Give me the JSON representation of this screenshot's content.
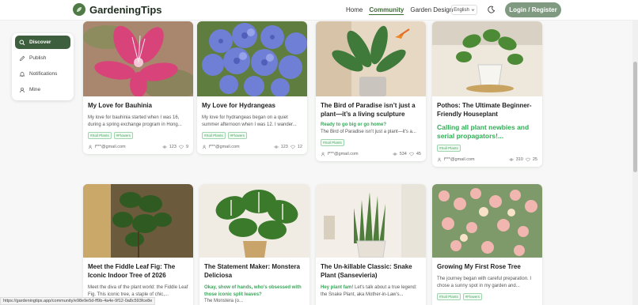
{
  "header": {
    "logo_text": "GardeningTips",
    "nav": [
      "Home",
      "Community",
      "Garden Design"
    ],
    "active_nav": "Community",
    "language": "English",
    "login_label": "Login / Register"
  },
  "sidebar": {
    "items": [
      {
        "label": "Discover",
        "icon": "search-icon",
        "active": true
      },
      {
        "label": "Publish",
        "icon": "pencil-icon",
        "active": false
      },
      {
        "label": "Notifications",
        "icon": "bell-icon",
        "active": false
      },
      {
        "label": "Mine",
        "icon": "user-icon",
        "active": false
      }
    ]
  },
  "posts": [
    {
      "title": "My Love for Bauhinia",
      "excerpt": "My love for bauhinia started when I was 16, during a spring exchange program in Hong...",
      "tags": [
        "#Soil Plants",
        "#Flowers"
      ],
      "author": "f***@gmail.com",
      "views": "123",
      "likes": "9"
    },
    {
      "title": "My Love for Hydrangeas",
      "excerpt": "My love for hydrangeas began on a quiet summer afternoon when I was 12. I wander...",
      "tags": [
        "#Soil Plants",
        "#Flowers"
      ],
      "author": "f***@gmail.com",
      "views": "123",
      "likes": "12"
    },
    {
      "title": "The Bird of Paradise isn’t just a plant—it’s a living sculpture",
      "highlight": "Ready to go big or go home?",
      "excerpt": "The Bird of Paradise isn’t just a plant—it's a...",
      "tags": [
        "#Soil Plants"
      ],
      "author": "f***@gmail.com",
      "views": "534",
      "likes": "45"
    },
    {
      "title": "Pothos: The Ultimate Beginner-Friendly Houseplant",
      "highlight": "Calling all plant newbies and serial propagators!...",
      "tags": [
        "#Soil Plants"
      ],
      "author": "f***@gmail.com",
      "views": "310",
      "likes": "25"
    },
    {
      "title": "Meet the Fiddle Leaf Fig: The Iconic Indoor Tree of 2026",
      "excerpt": "Meet the diva of the plant world: the Fiddle Leaf Fig. This iconic tree, a staple of chic,..."
    },
    {
      "title": "The Statement Maker: Monstera Deliciosa",
      "highlight": "Okay, show of hands, who's obsessed with those iconic split leaves?",
      "excerpt": "The Monstera (o..."
    },
    {
      "title": "The Un-killable Classic: Snake Plant (Sansevieria)",
      "highlight": "Hey plant fam!",
      "excerpt": "Let's talk about a true legend: the Snake Plant, aka Mother-in-Law's..."
    },
    {
      "title": "Growing My First Rose Tree",
      "excerpt": "The journey began with careful preparation. I chose a sunny spot in my garden and...",
      "tags": [
        "#Soil Plants",
        "#Flowers"
      ]
    }
  ],
  "status_url": "https://gardeningtips.app/community/e98e9e5d-ff9b-4a4e-9f12-0a8c593fce8e",
  "colors": {
    "brand": "#3e5f3e",
    "accent": "#3aa55a",
    "login": "#7f9a80"
  }
}
